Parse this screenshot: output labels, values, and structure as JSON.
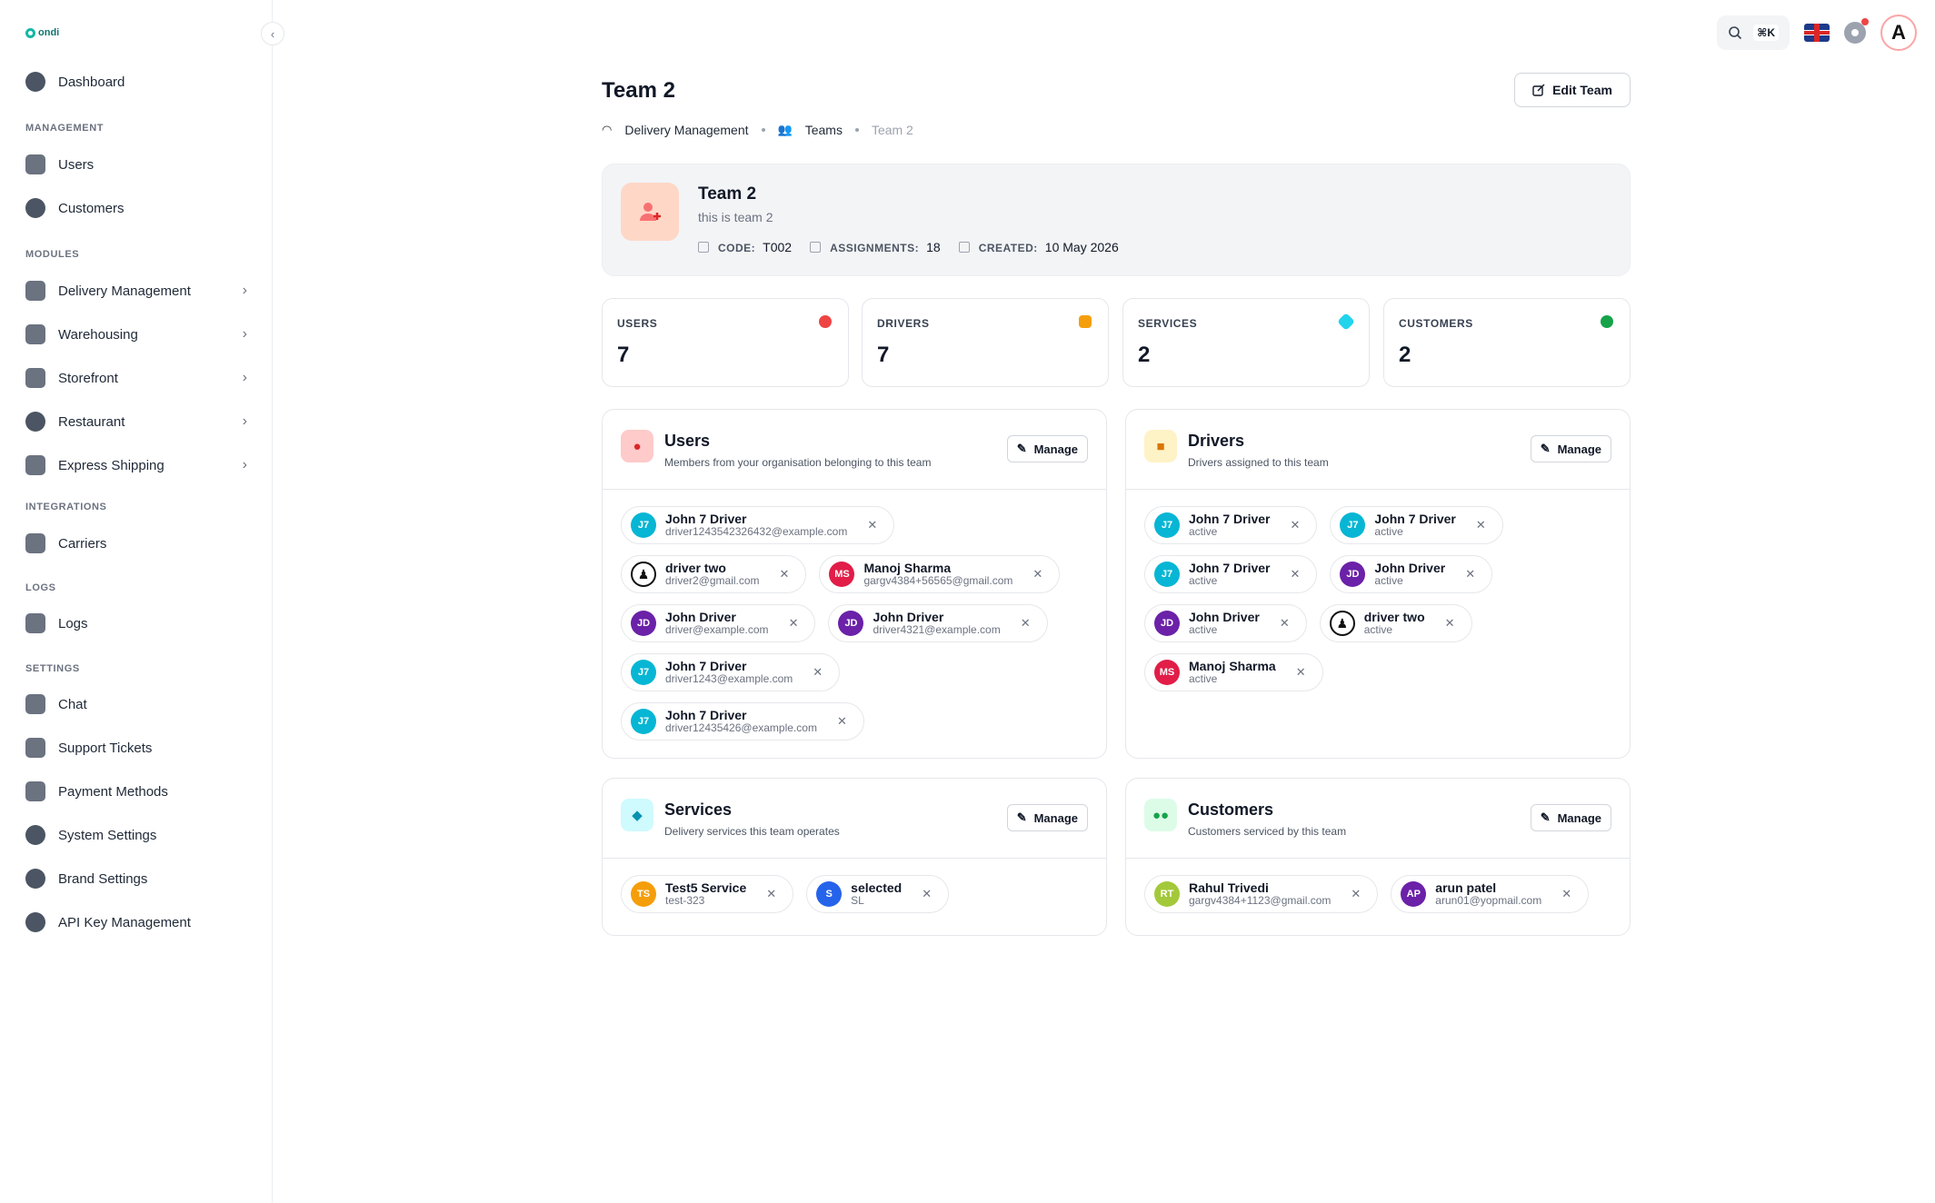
{
  "brand": {
    "logo_text": "ondi"
  },
  "sidebar": {
    "dashboard": "Dashboard",
    "sections": {
      "management": "MANAGEMENT",
      "modules": "MODULES",
      "integrations": "INTEGRATIONS",
      "logs": "LOGS",
      "settings": "SETTINGS"
    },
    "management_items": [
      "Users",
      "Customers"
    ],
    "module_items": [
      "Delivery Management",
      "Warehousing",
      "Storefront",
      "Restaurant",
      "Express Shipping"
    ],
    "integration_items": [
      "Carriers"
    ],
    "log_items": [
      "Logs"
    ],
    "setting_items": [
      "Chat",
      "Support Tickets",
      "Payment Methods",
      "System Settings",
      "Brand Settings",
      "API Key Management"
    ]
  },
  "topbar": {
    "shortcut": "⌘K"
  },
  "page": {
    "title": "Team 2",
    "edit_button": "Edit Team",
    "breadcrumb": [
      "Delivery Management",
      "Teams",
      "Team 2"
    ]
  },
  "hero": {
    "name": "Team 2",
    "description": "this is team 2",
    "code_label": "CODE:",
    "code": "T002",
    "assignments_label": "ASSIGNMENTS:",
    "assignments": "18",
    "created_label": "CREATED:",
    "created": "10 May 2026"
  },
  "stats": [
    {
      "label": "USERS",
      "value": "7",
      "color": "#ef4444"
    },
    {
      "label": "DRIVERS",
      "value": "7",
      "color": "#f59e0b"
    },
    {
      "label": "SERVICES",
      "value": "2",
      "color": "#06b6d4"
    },
    {
      "label": "CUSTOMERS",
      "value": "2",
      "color": "#16a34a"
    }
  ],
  "manage_label": "Manage",
  "users_card": {
    "title": "Users",
    "subtitle": "Members from your organisation belonging to this team",
    "items": [
      {
        "initials": "J7",
        "name": "John 7 Driver",
        "sub": "driver1243542326432@example.com"
      },
      {
        "initials": "",
        "name": "driver two",
        "sub": "driver2@gmail.com"
      },
      {
        "initials": "MS",
        "name": "Manoj Sharma",
        "sub": "gargv4384+56565@gmail.com"
      },
      {
        "initials": "JD",
        "name": "John Driver",
        "sub": "driver@example.com"
      },
      {
        "initials": "JD",
        "name": "John Driver",
        "sub": "driver4321@example.com"
      },
      {
        "initials": "J7",
        "name": "John 7 Driver",
        "sub": "driver1243@example.com"
      },
      {
        "initials": "J7",
        "name": "John 7 Driver",
        "sub": "driver12435426@example.com"
      }
    ]
  },
  "drivers_card": {
    "title": "Drivers",
    "subtitle": "Drivers assigned to this team",
    "items": [
      {
        "initials": "J7",
        "name": "John 7 Driver",
        "sub": "active"
      },
      {
        "initials": "J7",
        "name": "John 7 Driver",
        "sub": "active"
      },
      {
        "initials": "J7",
        "name": "John 7 Driver",
        "sub": "active"
      },
      {
        "initials": "JD",
        "name": "John Driver",
        "sub": "active"
      },
      {
        "initials": "JD",
        "name": "John Driver",
        "sub": "active"
      },
      {
        "initials": "",
        "name": "driver two",
        "sub": "active"
      },
      {
        "initials": "MS",
        "name": "Manoj Sharma",
        "sub": "active"
      }
    ]
  },
  "services_card": {
    "title": "Services",
    "subtitle": "Delivery services this team operates",
    "items": [
      {
        "initials": "TS",
        "name": "Test5 Service",
        "sub": "test-323"
      },
      {
        "initials": "S",
        "name": "selected",
        "sub": "SL"
      }
    ]
  },
  "customers_card": {
    "title": "Customers",
    "subtitle": "Customers serviced by this team",
    "items": [
      {
        "initials": "RT",
        "name": "Rahul Trivedi",
        "sub": "gargv4384+1123@gmail.com"
      },
      {
        "initials": "AP",
        "name": "arun patel",
        "sub": "arun01@yopmail.com"
      }
    ]
  }
}
